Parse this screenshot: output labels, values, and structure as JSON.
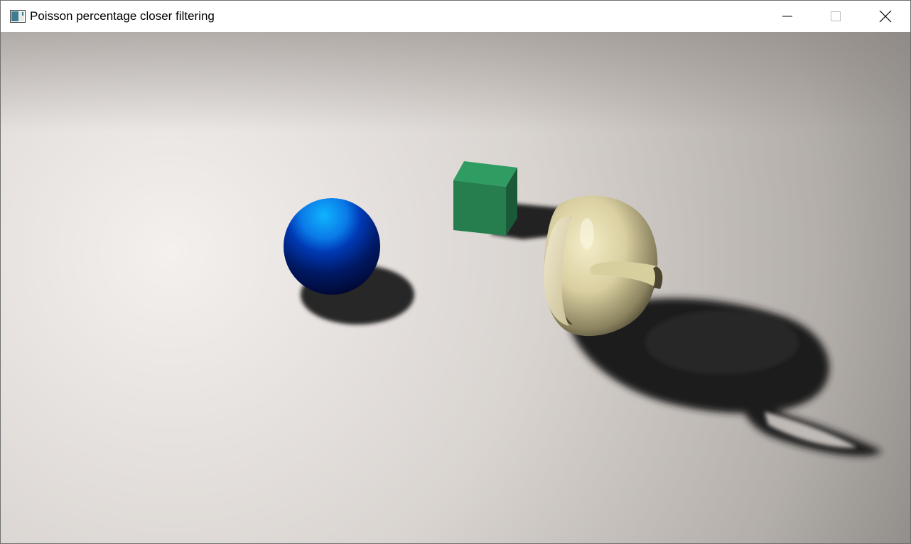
{
  "window": {
    "title": "Poisson percentage closer filtering",
    "icon": "app-window-icon"
  },
  "caption_buttons": {
    "minimize": "minimize-icon",
    "maximize": "maximize-icon",
    "close": "close-icon"
  },
  "scene": {
    "background_light": "#f4f0ee",
    "background_dark": "#8d8985",
    "objects": [
      {
        "name": "sphere",
        "color": "#0044cc"
      },
      {
        "name": "cube",
        "color": "#2a8a55"
      },
      {
        "name": "teapot",
        "color": "#e4dcb0"
      }
    ]
  }
}
